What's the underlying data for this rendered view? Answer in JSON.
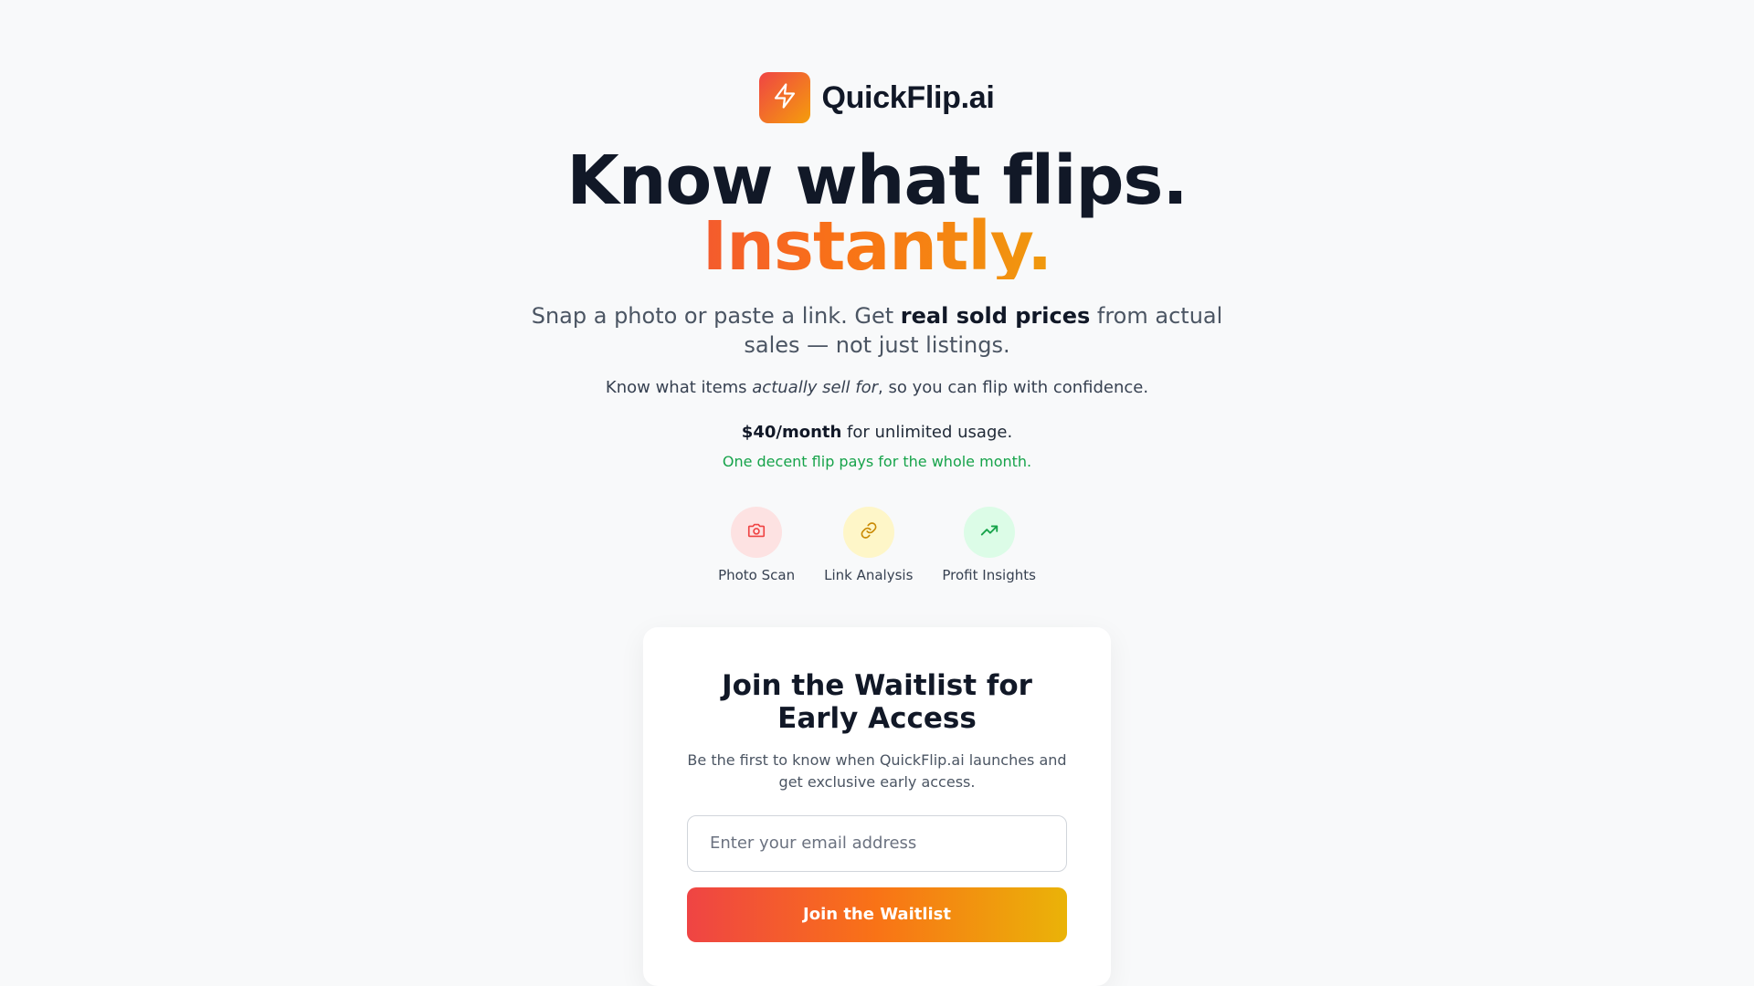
{
  "brand": {
    "name": "QuickFlip.ai",
    "logo_icon": "lightning-bolt-icon",
    "logo_gradient": [
      "#ef4444",
      "#f59e0b"
    ]
  },
  "hero": {
    "headline_line1": "Know what flips.",
    "headline_line2": "Instantly.",
    "sub_part1": "Snap a photo or paste a link. Get ",
    "sub_bold": "real sold prices",
    "sub_part2": " from actual sales — not just listings.",
    "sub2_part1": "Know what items ",
    "sub2_em": "actually sell for",
    "sub2_part2": ", so you can flip with confidence.",
    "price_bold": "$40/month",
    "price_rest": " for unlimited usage.",
    "price_note": "One decent flip pays for the whole month."
  },
  "features": [
    {
      "label": "Photo Scan",
      "icon": "camera-icon",
      "bg": "#fde2e2",
      "color": "#ef4444"
    },
    {
      "label": "Link Analysis",
      "icon": "link-icon",
      "bg": "#fef6c8",
      "color": "#ca8a04"
    },
    {
      "label": "Profit Insights",
      "icon": "trending-up-icon",
      "bg": "#dcfce7",
      "color": "#16a34a"
    }
  ],
  "waitlist": {
    "title": "Join the Waitlist for Early Access",
    "description": "Be the first to know when QuickFlip.ai launches and get exclusive early access.",
    "email_placeholder": "Enter your email address",
    "email_value": "",
    "button_label": "Join the Waitlist"
  },
  "colors": {
    "accent_start": "#ef4444",
    "accent_end": "#eab308",
    "success": "#16a34a",
    "background": "#f8f9fa"
  }
}
